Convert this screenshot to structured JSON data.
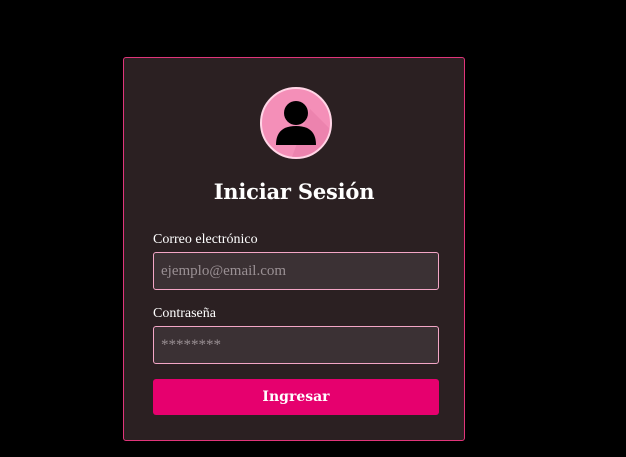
{
  "login": {
    "title": "Iniciar Sesión",
    "avatar_icon": "user-avatar-icon",
    "email": {
      "label": "Correo electrónico",
      "placeholder": "ejemplo@email.com",
      "value": ""
    },
    "password": {
      "label": "Contraseña",
      "placeholder": "********",
      "value": ""
    },
    "submit_label": "Ingresar"
  },
  "colors": {
    "background": "#000000",
    "card": "#2b2022",
    "card_border": "#e0357a",
    "avatar": "#f48fb8",
    "input_bg": "#3b3134",
    "input_border": "#f3a6c6",
    "button": "#e6006e",
    "text": "#ffffff"
  }
}
